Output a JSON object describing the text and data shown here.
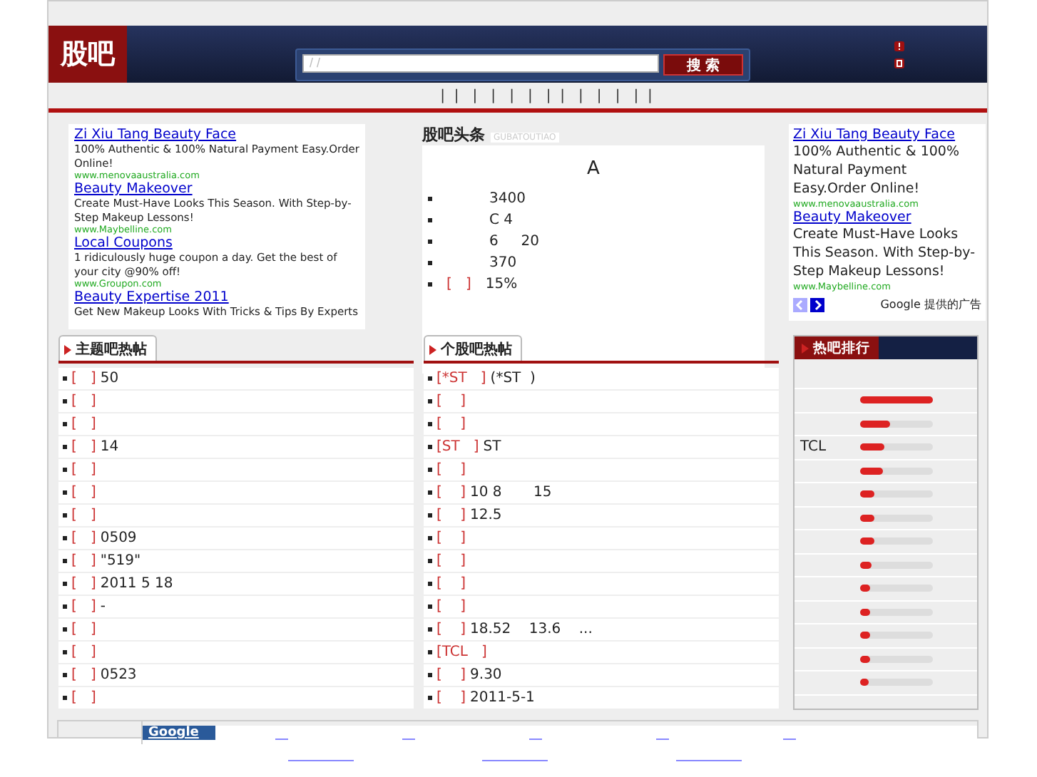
{
  "header": {
    "logo": "股吧",
    "search": {
      "placeholder": "/ /",
      "button": "搜 索"
    }
  },
  "nav_text": "|  |   |   |   |   |   |  |   |   |   |   |  |",
  "ads_left": [
    {
      "title": "Zi Xiu Tang Beauty Face",
      "text": "100% Authentic & 100% Natural Payment Easy.Order Online!",
      "url": "www.menovaaustralia.com"
    },
    {
      "title": "Beauty Makeover",
      "text": "Create Must-Have Looks This Season. With Step-by-Step Makeup Lessons!",
      "url": "www.Maybelline.com"
    },
    {
      "title": "Local Coupons",
      "text": "1 ridiculously huge coupon a day. Get the best of your city @90% off!",
      "url": "www.Groupon.com"
    },
    {
      "title": "Beauty Expertise 2011",
      "text": "Get New Makeup Looks With Tricks & Tips By Experts"
    }
  ],
  "headlines": {
    "title": "股吧头条",
    "subtitle": "GUBATOUTIAO",
    "top": "A",
    "items": [
      {
        "text": "3400"
      },
      {
        "text": "C 4"
      },
      {
        "text": "6     20"
      },
      {
        "text": "370"
      },
      {
        "tag": "[   ]",
        "text": "15%"
      }
    ]
  },
  "ads_right": {
    "items": [
      {
        "title": "Zi Xiu Tang Beauty Face",
        "text": "100% Authentic & 100% Natural Payment Easy.Order Online!",
        "url": "www.menovaaustralia.com"
      },
      {
        "title": "Beauty Makeover",
        "text": "Create Must-Have Looks This Season. With Step-by-Step Makeup Lessons!",
        "url": "www.Maybelline.com"
      }
    ],
    "footer": "Google 提供的广告"
  },
  "topic_posts": {
    "title": "主题吧热帖",
    "rows": [
      {
        "tag": "[   ]",
        "text": "50"
      },
      {
        "tag": "[   ]"
      },
      {
        "tag": "[   ]"
      },
      {
        "tag": "[   ]",
        "text": "14"
      },
      {
        "tag": "[   ]"
      },
      {
        "tag": "[   ]"
      },
      {
        "tag": "[   ]"
      },
      {
        "tag": "[   ]",
        "text": "0509"
      },
      {
        "tag": "[   ]",
        "text": "\"519\""
      },
      {
        "tag": "[   ]",
        "text": "2011 5 18"
      },
      {
        "tag": "[   ]",
        "text": "-"
      },
      {
        "tag": "[   ]"
      },
      {
        "tag": "[   ]"
      },
      {
        "tag": "[   ]",
        "text": "0523"
      },
      {
        "tag": "[   ]"
      }
    ]
  },
  "stock_posts": {
    "title": "个股吧热帖",
    "rows": [
      {
        "tag": "[*ST   ]",
        "text": "(*ST  )"
      },
      {
        "tag": "[    ]"
      },
      {
        "tag": "[    ]"
      },
      {
        "tag": "[ST   ]",
        "text": "ST"
      },
      {
        "tag": "[    ]"
      },
      {
        "tag": "[    ]",
        "text": "10 8       15"
      },
      {
        "tag": "[    ]",
        "text": "12.5"
      },
      {
        "tag": "[    ]"
      },
      {
        "tag": "[    ]"
      },
      {
        "tag": "[    ]"
      },
      {
        "tag": "[    ]"
      },
      {
        "tag": "[    ]",
        "text": "18.52    13.6    ..."
      },
      {
        "tag": "[TCL   ]"
      },
      {
        "tag": "[    ]",
        "text": "9.30"
      },
      {
        "tag": "[    ]",
        "text": "2011-5-1"
      }
    ]
  },
  "hot_rank": {
    "title": "热吧排行",
    "rows": [
      {
        "level": 1.0
      },
      {
        "level": 0.41
      },
      {
        "name": "TCL",
        "level": 0.33
      },
      {
        "level": 0.31
      },
      {
        "level": 0.2
      },
      {
        "level": 0.19
      },
      {
        "level": 0.19
      },
      {
        "level": 0.15
      },
      {
        "level": 0.14
      },
      {
        "level": 0.14
      },
      {
        "level": 0.14
      },
      {
        "level": 0.14
      },
      {
        "level": 0.12
      }
    ]
  },
  "bottom_search": {
    "label": "Google"
  }
}
